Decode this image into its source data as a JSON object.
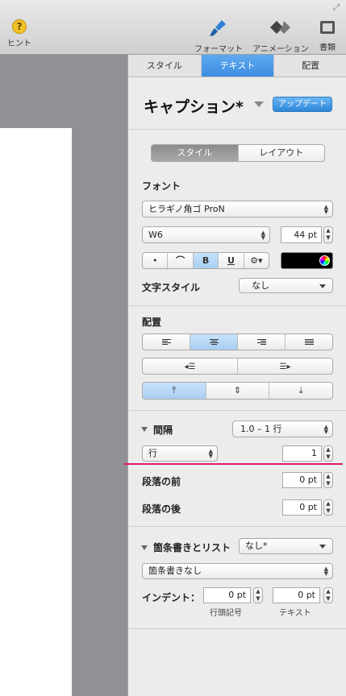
{
  "toolbar": {
    "hint": "ヒント",
    "format": "フォーマット",
    "animation": "アニメーション",
    "document": "書類"
  },
  "inspector": {
    "tabs": [
      "スタイル",
      "テキスト",
      "配置"
    ],
    "style_name": "キャプション*",
    "update_button": "アップデート",
    "subtabs": [
      "スタイル",
      "レイアウト"
    ],
    "font_section": "フォント",
    "font_family": "ヒラギノ角ゴ ProN",
    "font_weight": "W6",
    "font_size": "44 pt",
    "bold": "B",
    "underline": "U",
    "char_style_label": "文字スタイル",
    "char_style_value": "なし",
    "alignment_label": "配置",
    "spacing_label": "間隔",
    "spacing_value": "1.0 – 1 行",
    "line_mode": "行",
    "line_value": "1",
    "before_label": "段落の前",
    "before_value": "0 pt",
    "after_label": "段落の後",
    "after_value": "0 pt",
    "bullets_label": "箇条書きとリスト",
    "bullets_value": "なし*",
    "bullets_type": "箇条書きなし",
    "indent_label": "インデント：",
    "indent_bullet_value": "0 pt",
    "indent_text_value": "0 pt",
    "indent_bullet_caption": "行頭記号",
    "indent_text_caption": "テキスト"
  },
  "colors": {
    "accent": "#3b8de0",
    "text_color_swatch": "#000000",
    "highlight_line": "#e0196f"
  }
}
